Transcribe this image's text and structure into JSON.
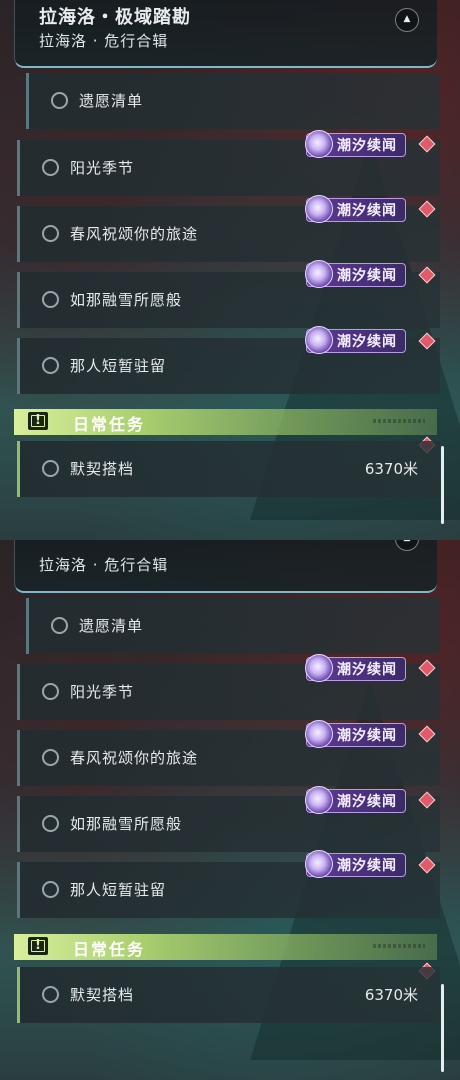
{
  "panel": {
    "title": "拉海洛・极域踏勘",
    "subtitle": "拉海洛 · 危行合辑",
    "quests": [
      {
        "label": "遗愿清单"
      },
      {
        "label": "阳光季节"
      },
      {
        "label": "春风祝颂你的旅途"
      },
      {
        "label": "如那融雪所愿般"
      },
      {
        "label": "那人短暂驻留"
      }
    ],
    "tag_label": "潮汐续闻",
    "daily_section": {
      "title": "日常任务",
      "quest": {
        "label": "默契搭档",
        "distance": "6370米"
      }
    }
  },
  "colors": {
    "accent_green": "#a9cf6f",
    "tag_purple": "#5e3a96",
    "marker_red": "#e05a6a",
    "header_line": "#7fb8c6"
  },
  "icons": [
    "collapse-up-icon",
    "radio-empty-icon",
    "tidal-tag-icon",
    "diamond-marker-icon",
    "exclamation-icon"
  ]
}
